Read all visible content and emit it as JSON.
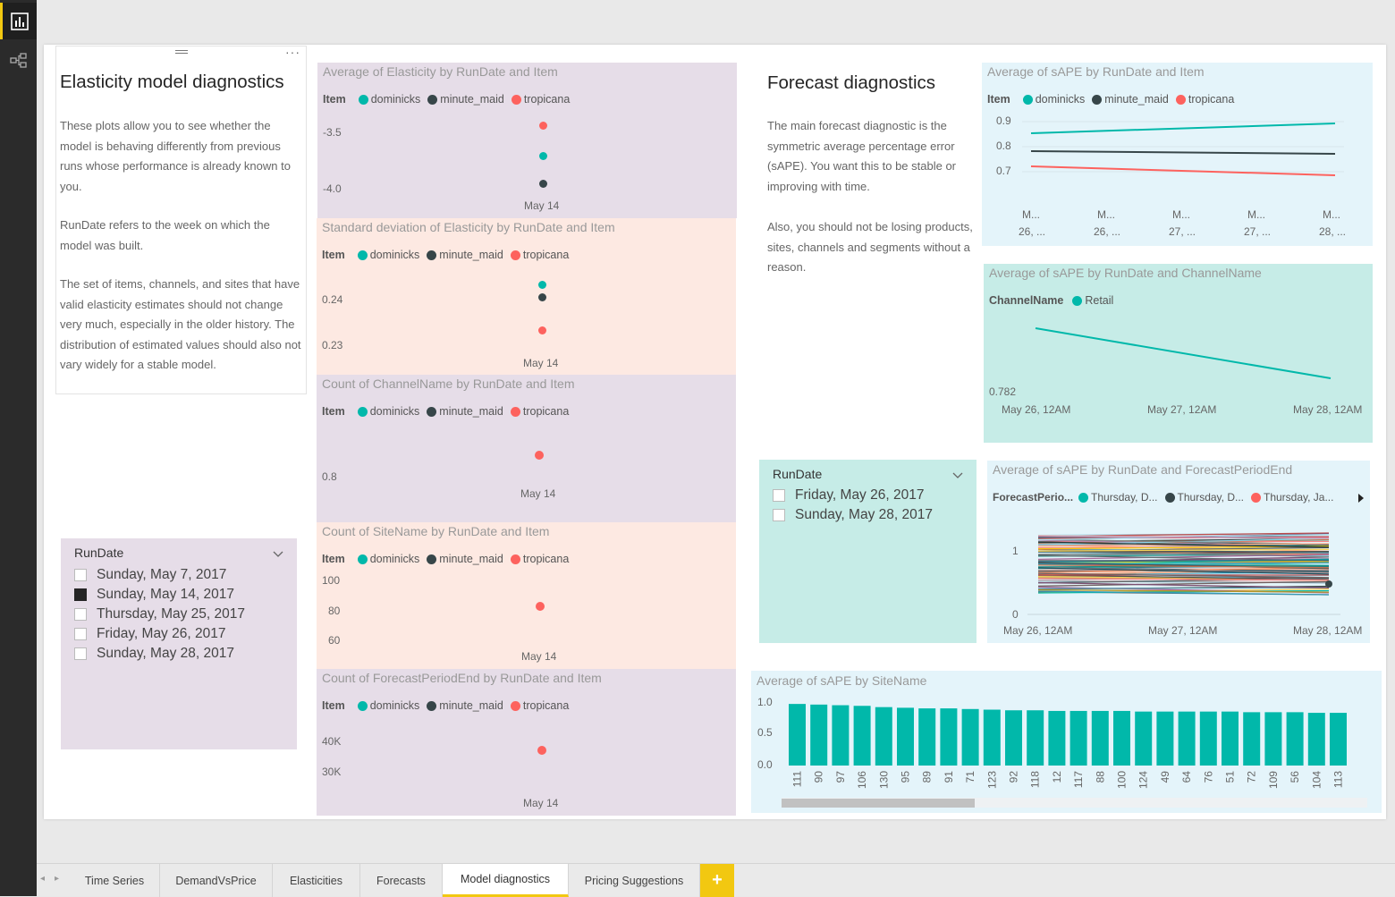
{
  "tabs": [
    "Time Series",
    "DemandVsPrice",
    "Elasticities",
    "Forecasts",
    "Model diagnostics",
    "Pricing Suggestions"
  ],
  "active_tab": "Model diagnostics",
  "add_page": "+",
  "elasticity_text": {
    "title": "Elasticity model diagnostics",
    "p1": "These plots allow you to see whether the model is behaving differently from previous runs whose performance is already known to you.",
    "p2": "RunDate refers to the week on which the model was built.",
    "p3": "The set of items, channels, and sites that have valid elasticity estimates should not change very much, especially in the older history. The distribution of estimated values should also not vary widely for a stable model."
  },
  "slicer_left": {
    "title": "RunDate",
    "items": [
      {
        "label": "Sunday, May 7, 2017",
        "checked": false
      },
      {
        "label": "Sunday, May 14, 2017",
        "checked": true
      },
      {
        "label": "Thursday, May 25, 2017",
        "checked": false
      },
      {
        "label": "Friday, May 26, 2017",
        "checked": false
      },
      {
        "label": "Sunday, May 28, 2017",
        "checked": false
      }
    ]
  },
  "legend": {
    "title": "Item",
    "items": [
      "dominicks",
      "minute_maid",
      "tropicana"
    ]
  },
  "colors": {
    "dominicks": "#01b8aa",
    "minute_maid": "#374649",
    "tropicana": "#fd625e",
    "accent": "#f2c811"
  },
  "dot_charts": [
    {
      "title": "Average of Elasticity by RunDate and Item",
      "yticks": [
        "-3.5",
        "-4.0"
      ],
      "x": "May 14"
    },
    {
      "title": "Standard deviation of Elasticity by RunDate and Item",
      "yticks": [
        "0.24",
        "0.23"
      ],
      "x": "May 14"
    },
    {
      "title": "Count of ChannelName by RunDate and Item",
      "yticks": [
        "0.8"
      ],
      "x": "May 14"
    },
    {
      "title": "Count of SiteName by RunDate and Item",
      "yticks": [
        "100",
        "80",
        "60"
      ],
      "x": "May 14"
    },
    {
      "title": "Count of ForecastPeriodEnd by RunDate and Item",
      "yticks": [
        "40K",
        "30K"
      ],
      "x": "May 14"
    }
  ],
  "forecast_text": {
    "title": "Forecast diagnostics",
    "p1": "The main forecast diagnostic is the symmetric average percentage error (sAPE). You want this to be stable or improving with time.",
    "p2": "Also, you should not be losing products, sites, channels and segments without a reason."
  },
  "sape_item": {
    "title": "Average of sAPE by RunDate and Item",
    "yticks": [
      "0.9",
      "0.8",
      "0.7"
    ],
    "xtop": [
      "M...",
      "M...",
      "M...",
      "M...",
      "M..."
    ],
    "xbot": [
      "26, ...",
      "26, ...",
      "27, ...",
      "27, ...",
      "28, ..."
    ]
  },
  "sape_channel": {
    "title": "Average of sAPE by RunDate and ChannelName",
    "legend_title": "ChannelName",
    "legend_item": "Retail",
    "ytick": "0.782",
    "x": [
      "May 26, 12AM",
      "May 27, 12AM",
      "May 28, 12AM"
    ]
  },
  "slicer_right": {
    "title": "RunDate",
    "items": [
      {
        "label": "Friday, May 26, 2017",
        "checked": false
      },
      {
        "label": "Sunday, May 28, 2017",
        "checked": false
      }
    ]
  },
  "sape_fpe": {
    "title": "Average of sAPE by RunDate and ForecastPeriodEnd",
    "legend_title": "ForecastPerio...",
    "legend_items": [
      "Thursday, D...",
      "Thursday, D...",
      "Thursday, Ja..."
    ],
    "yticks": [
      "1",
      "0"
    ],
    "x": [
      "May 26, 12AM",
      "May 27, 12AM",
      "May 28, 12AM"
    ]
  },
  "chart_data": [
    {
      "type": "bar",
      "title": "Average of sAPE by SiteName",
      "categories": [
        "111",
        "90",
        "97",
        "106",
        "130",
        "95",
        "89",
        "91",
        "71",
        "123",
        "92",
        "118",
        "12",
        "117",
        "88",
        "100",
        "124",
        "49",
        "64",
        "76",
        "51",
        "72",
        "109",
        "56",
        "104",
        "113"
      ],
      "values": [
        0.97,
        0.96,
        0.95,
        0.94,
        0.92,
        0.91,
        0.9,
        0.9,
        0.89,
        0.88,
        0.87,
        0.87,
        0.86,
        0.86,
        0.86,
        0.86,
        0.85,
        0.85,
        0.85,
        0.85,
        0.85,
        0.84,
        0.84,
        0.84,
        0.83,
        0.83
      ],
      "yticks": [
        "1.0",
        "0.5",
        "0.0"
      ],
      "ylim": [
        0,
        1.0
      ]
    }
  ]
}
